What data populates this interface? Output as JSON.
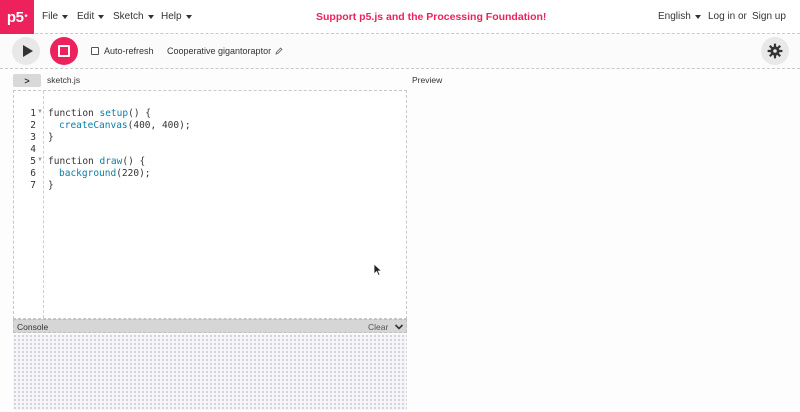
{
  "nav": {
    "logo_text": "p5",
    "logo_sup": "*",
    "menus": [
      {
        "label": "File"
      },
      {
        "label": "Edit"
      },
      {
        "label": "Sketch"
      },
      {
        "label": "Help"
      }
    ],
    "support_text": "Support p5.js and the Processing Foundation!",
    "language": "English",
    "login": "Log in",
    "or": "or",
    "signup": "Sign up"
  },
  "toolbar": {
    "auto_refresh_label": "Auto-refresh",
    "auto_refresh_checked": false,
    "sketch_name": "Cooperative gigantoraptor"
  },
  "editor": {
    "collapse_icon": ">",
    "file_name": "sketch.js",
    "lines": [
      {
        "num": "1",
        "fold": true
      },
      {
        "num": "2",
        "fold": false
      },
      {
        "num": "3",
        "fold": false
      },
      {
        "num": "4",
        "fold": false
      },
      {
        "num": "5",
        "fold": true
      },
      {
        "num": "6",
        "fold": false
      },
      {
        "num": "7",
        "fold": false
      }
    ]
  },
  "code": {
    "l1_kw": "function ",
    "l1_fn": "setup",
    "l1_rest": "() {",
    "l2_fn": "createCanvas",
    "l2_rest": "(400, 400);",
    "l3": "}",
    "l5_kw": "function ",
    "l5_fn": "draw",
    "l5_rest": "() {",
    "l6_fn": "background",
    "l6_rest": "(220);",
    "l7": "}"
  },
  "preview": {
    "label": "Preview"
  },
  "console": {
    "label": "Console",
    "clear_label": "Clear"
  },
  "colors": {
    "brand": "#ed225d",
    "function": "#0b7ca9"
  }
}
